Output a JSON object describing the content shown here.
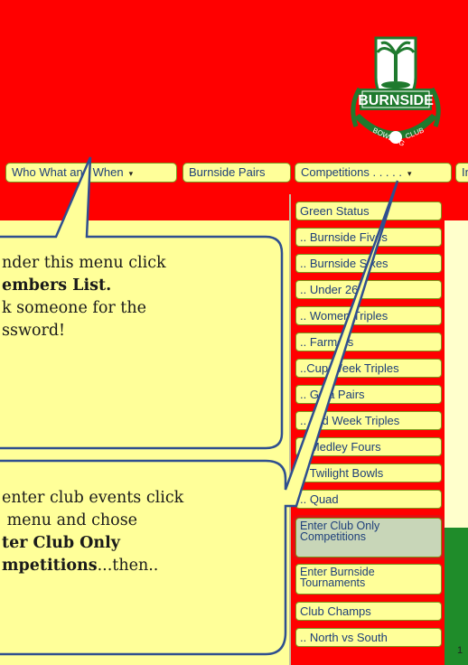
{
  "logo": {
    "word": "BURNSIDE",
    "arc_left": "BOWLING",
    "arc_right": "CLUB"
  },
  "nav": {
    "items": [
      {
        "label": "Who What and When",
        "caret": "▾"
      },
      {
        "label": "Burnside Pairs"
      },
      {
        "label": "Competitions . . . . .",
        "caret": "▾"
      },
      {
        "label": "In"
      }
    ]
  },
  "dropdown": {
    "items": [
      "Green Status",
      ".. Burnside Fives",
      ".. Burnside Sixes",
      ".. Under 26",
      ".. Women Triples",
      ".. Farmers",
      "..Cup Week Triples",
      ".. Gala Pairs",
      ".. Mid Week Triples",
      ".. Medley Fours",
      ".. Twilight Bowls",
      ".. Quad",
      "Enter Club Only Competitions",
      "Enter Burnside Tournaments",
      "Club Champs",
      ".. North vs South"
    ]
  },
  "callout1": {
    "line1": "nder this menu click",
    "line2_bold": "embers List.",
    "line3": "k someone for the",
    "line4": "ssword!"
  },
  "callout2": {
    "line1": "enter club events click",
    "line2": " menu and chose",
    "line3_bold": "ter Club Only",
    "line4_bold": "mpetitions",
    "line4_rest": "...then.."
  },
  "stray_digit": "1",
  "colors": {
    "page_bg": "#ff0000",
    "button_bg": "#ffff99",
    "button_border": "#7a9a1e",
    "callout_border": "#2f4f8f",
    "highlight": "#e01010"
  }
}
